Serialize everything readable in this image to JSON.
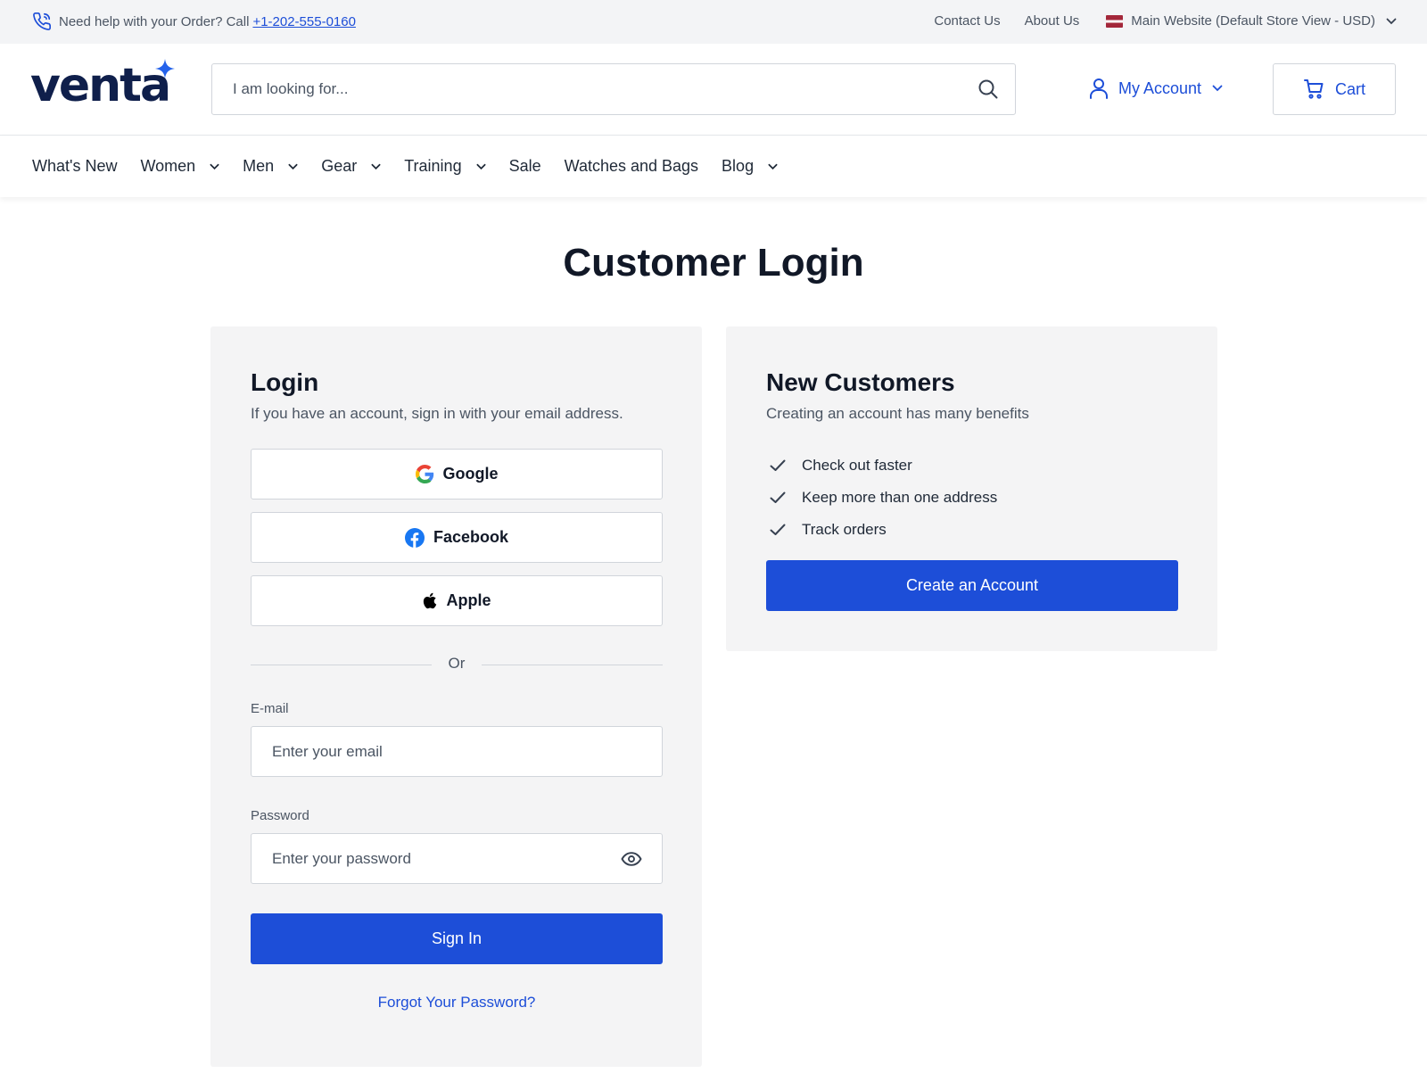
{
  "topbar": {
    "help_text": "Need help with your Order? Call",
    "phone": "+1-202-555-0160",
    "links": [
      "Contact Us",
      "About Us"
    ],
    "store": "Main Website (Default Store View - USD)"
  },
  "header": {
    "logo": "venta",
    "search_placeholder": "I am looking for...",
    "account_label": "My Account",
    "cart_label": "Cart"
  },
  "nav": [
    {
      "label": "What's New",
      "dropdown": false
    },
    {
      "label": "Women",
      "dropdown": true
    },
    {
      "label": "Men",
      "dropdown": true
    },
    {
      "label": "Gear",
      "dropdown": true
    },
    {
      "label": "Training",
      "dropdown": true
    },
    {
      "label": "Sale",
      "dropdown": false
    },
    {
      "label": "Watches and Bags",
      "dropdown": false
    },
    {
      "label": "Blog",
      "dropdown": true
    }
  ],
  "page_title": "Customer Login",
  "login": {
    "heading": "Login",
    "subtitle": "If you have an account, sign in with your email address.",
    "social": {
      "google": "Google",
      "facebook": "Facebook",
      "apple": "Apple"
    },
    "divider": "Or",
    "email_label": "E-mail",
    "email_placeholder": "Enter your email",
    "password_label": "Password",
    "password_placeholder": "Enter your password",
    "sign_in": "Sign In",
    "forgot": "Forgot Your Password?"
  },
  "new_customers": {
    "heading": "New Customers",
    "subtitle": "Creating an account has many benefits",
    "benefits": [
      "Check out faster",
      "Keep more than one address",
      "Track orders"
    ],
    "create_button": "Create an Account"
  },
  "colors": {
    "accent": "#1d4ed8",
    "panel": "#f4f4f5",
    "brand_dark": "#0f1f4b",
    "brand_star": "#2563eb"
  }
}
